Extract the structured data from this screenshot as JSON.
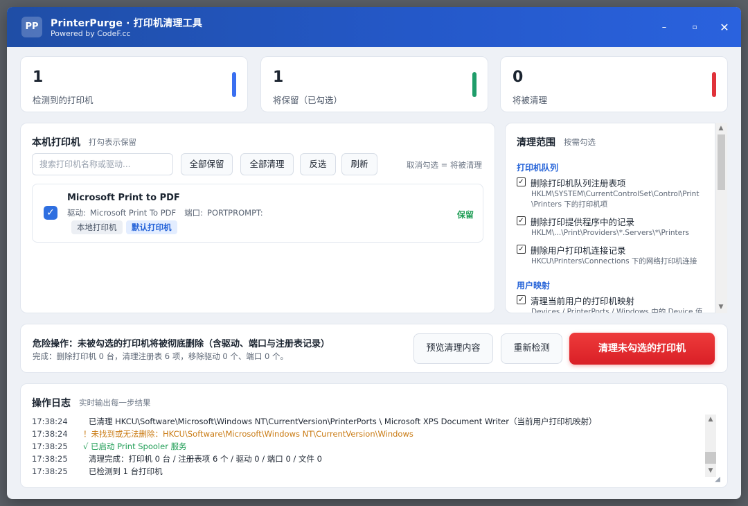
{
  "window": {
    "logo": "PP",
    "title": "PrinterPurge · 打印机清理工具",
    "subtitle": "Powered by CodeF.cc",
    "min": "–",
    "max": "▫",
    "close": "✕"
  },
  "stats": [
    {
      "value": "1",
      "label": "检测到的打印机",
      "color": "#3a6ff0"
    },
    {
      "value": "1",
      "label": "将保留（已勾选）",
      "color": "#1f9d6a"
    },
    {
      "value": "0",
      "label": "将被清理",
      "color": "#e0323a"
    }
  ],
  "printers_panel": {
    "title": "本机打印机",
    "hint": "打勾表示保留",
    "search_placeholder": "搜索打印机名称或驱动...",
    "buttons": {
      "keep_all": "全部保留",
      "clean_all": "全部清理",
      "invert": "反选",
      "refresh": "刷新"
    },
    "note": "取消勾选 = 将被清理",
    "items": [
      {
        "checkmark": "✓",
        "name": "Microsoft Print to PDF",
        "driver_label": "驱动:",
        "driver": "Microsoft Print To PDF",
        "port_label": "端口:",
        "port": "PORTPROMPT:",
        "tag_local": "本地打印机",
        "tag_default": "默认打印机",
        "status": "保留"
      }
    ]
  },
  "scope_panel": {
    "title": "清理范围",
    "hint": "按需勾选",
    "groups": [
      {
        "name": "打印机队列",
        "options": [
          {
            "check": "✓",
            "label": "删除打印机队列注册表项",
            "desc": "HKLM\\SYSTEM\\CurrentControlSet\\Control\\Print\\Printers 下的打印机项"
          },
          {
            "check": "✓",
            "label": "删除打印提供程序中的记录",
            "desc": "HKLM\\...\\Print\\Providers\\*.Servers\\*\\Printers"
          },
          {
            "check": "✓",
            "label": "删除用户打印机连接记录",
            "desc": "HKCU\\Printers\\Connections 下的网络打印机连接"
          }
        ]
      },
      {
        "name": "用户映射",
        "options": [
          {
            "check": "✓",
            "label": "清理当前用户的打印机映射",
            "desc": "Devices / PrinterPorts / Windows 中的 Device 值"
          }
        ]
      }
    ]
  },
  "action_bar": {
    "title": "危险操作：未被勾选的打印机将被彻底删除（含驱动、端口与注册表记录）",
    "status": "完成：删除打印机 0 台，清理注册表 6 项，移除驱动 0 个、端口 0 个。",
    "preview": "预览清理内容",
    "rescan": "重新检测",
    "clean": "清理未勾选的打印机"
  },
  "log": {
    "title": "操作日志",
    "hint": "实时输出每一步结果",
    "entries": [
      {
        "time": "17:38:24",
        "text": "已清理 HKCU\\Software\\Microsoft\\Windows NT\\CurrentVersion\\PrinterPorts \\ Microsoft XPS Document Writer（当前用户打印机映射）",
        "type": "info"
      },
      {
        "time": "17:38:24",
        "text": "！未找到或无法删除：HKCU\\Software\\Microsoft\\Windows NT\\CurrentVersion\\Windows",
        "type": "warn"
      },
      {
        "time": "17:38:25",
        "text": "√ 已启动 Print Spooler 服务",
        "type": "ok"
      },
      {
        "time": "17:38:25",
        "text": "清理完成：打印机 0 台 / 注册表项 6 个 / 驱动 0 / 端口 0 / 文件 0",
        "type": "info"
      },
      {
        "time": "17:38:25",
        "text": "已检测到 1 台打印机",
        "type": "info"
      }
    ]
  },
  "scroll": {
    "up": "▲",
    "down": "▼"
  },
  "grip": "◢"
}
